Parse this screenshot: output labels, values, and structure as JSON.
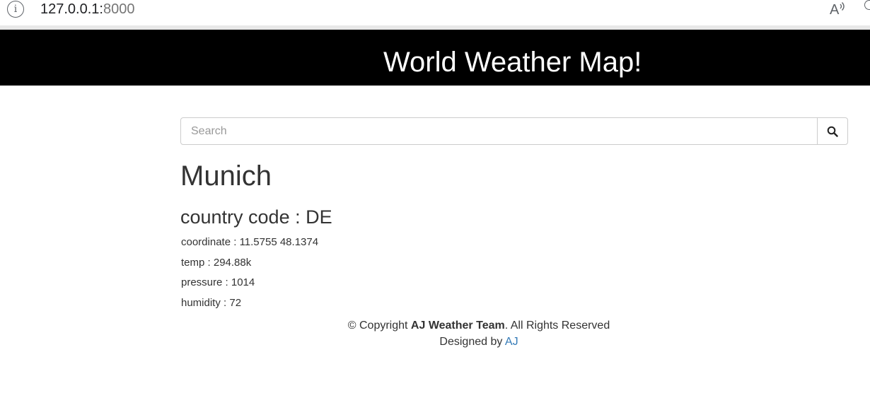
{
  "browser": {
    "url_host": "127.0.0.1:",
    "url_port": "8000",
    "read_aloud_label": "Aͅ"
  },
  "header": {
    "title": "World Weather Map!"
  },
  "search": {
    "placeholder": "Search",
    "value": ""
  },
  "weather": {
    "city": "Munich",
    "country_code_label": "country code : ",
    "country_code": "DE",
    "coordinate_label": "coordinate : ",
    "coordinate": "11.5755 48.1374",
    "temp_label": "temp : ",
    "temp": "294.88k",
    "pressure_label": "pressure : ",
    "pressure": "1014",
    "humidity_label": "humidity : ",
    "humidity": "72"
  },
  "footer": {
    "copyright_prefix": "© Copyright ",
    "team": "AJ Weather Team",
    "copyright_suffix": ". All Rights Reserved",
    "designed_by_label": "Designed by ",
    "designer_link": "AJ"
  },
  "colors": {
    "header_bg": "#000000",
    "header_text": "#ffffff",
    "link": "#337ab7",
    "text": "#333333"
  },
  "icons": {
    "info": "info-icon",
    "search": "search-icon",
    "read_aloud": "read-aloud-icon"
  }
}
